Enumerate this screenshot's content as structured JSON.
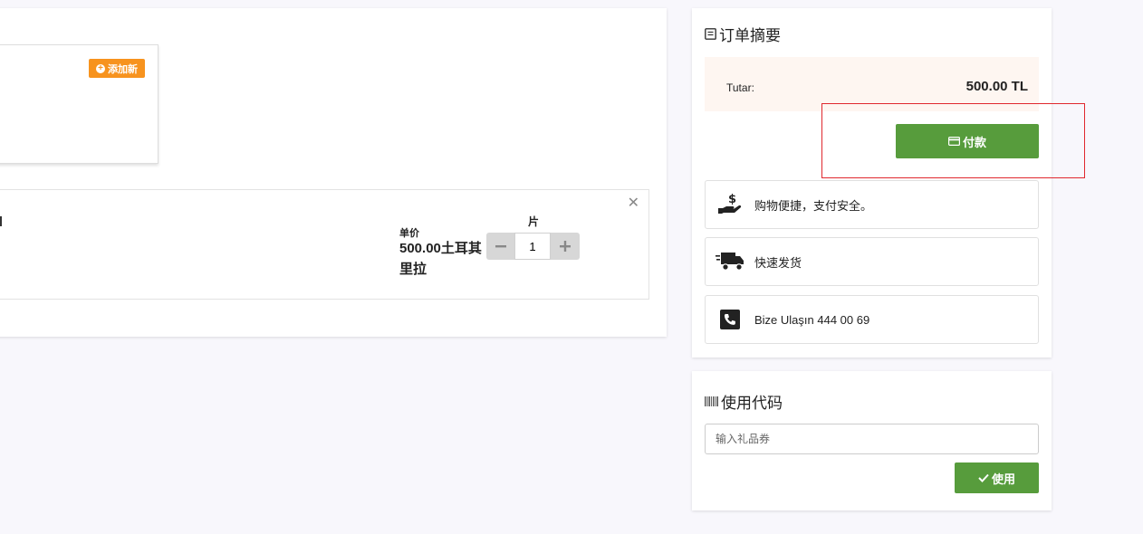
{
  "cart": {
    "add_new_label": "添加新",
    "unit_price_label": "单价",
    "unit_price_value": "500.00土耳其里拉",
    "quantity_label": "片",
    "quantity_value": "1",
    "remove_icon": "close-icon"
  },
  "summary": {
    "title": "订单摘要",
    "total_label": "Tutar:",
    "total_value": "500.00 TL",
    "pay_label": "付款",
    "features": [
      {
        "icon": "hand-money-icon",
        "text": "购物便捷，支付安全。"
      },
      {
        "icon": "delivery-truck-icon",
        "text": "快速发货"
      },
      {
        "icon": "phone-icon",
        "text": "Bize Ulaşın 444 00 69"
      }
    ]
  },
  "coupon": {
    "title": "使用代码",
    "placeholder": "输入礼品券",
    "apply_label": "使用"
  },
  "colors": {
    "accent_orange": "#f7931e",
    "button_green": "#579c3c",
    "total_bg": "#fef6f1",
    "highlight_red": "#e0282e"
  }
}
